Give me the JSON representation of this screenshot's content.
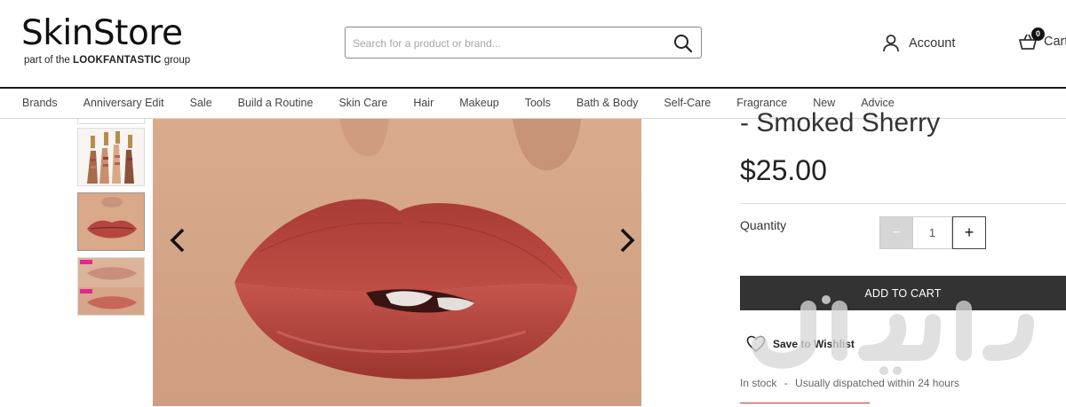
{
  "header": {
    "logo_main": "SkinStore",
    "logo_sub_prefix": "part of the",
    "logo_sub_brand": "LOOKFANTASTIC",
    "logo_sub_suffix": "group",
    "search_placeholder": "Search for a product or brand...",
    "account_label": "Account",
    "cart_label": "Cart",
    "cart_count": "0"
  },
  "nav": {
    "items": [
      "Brands",
      "Anniversary Edit",
      "Sale",
      "Build a Routine",
      "Skin Care",
      "Hair",
      "Makeup",
      "Tools",
      "Bath & Body",
      "Self-Care",
      "Fragrance",
      "New",
      "Advice"
    ]
  },
  "product": {
    "title_fragment": "- Smoked Sherry",
    "price": "$25.00",
    "quantity_label": "Quantity",
    "quantity_value": "1",
    "minus": "−",
    "plus": "+",
    "add_to_cart": "ADD TO CART",
    "wishlist": "Save to Wishlist",
    "stock_status": "In stock",
    "stock_separator": "-",
    "dispatch": "Usually dispatched within 24 hours"
  },
  "colors": {
    "lip_red": "#b4453f",
    "skin": "#d8a98a",
    "button_dark": "#333333"
  },
  "icons": [
    "search-icon",
    "user-icon",
    "basket-icon",
    "chevron-left-icon",
    "chevron-right-icon",
    "heart-icon"
  ]
}
